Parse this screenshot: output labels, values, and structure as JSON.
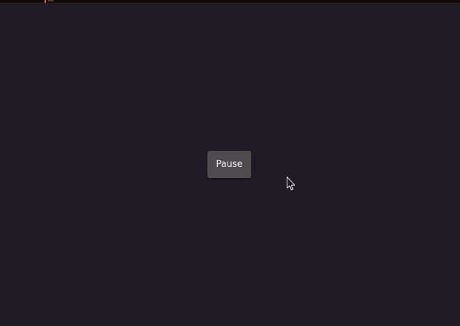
{
  "window": {
    "background_color": "#1f1c25",
    "top_bar_color": "#120d0c",
    "accent_marker_color": "#e0684a"
  },
  "controls": {
    "pause_label": "Pause",
    "pause_button_color": "#4e4b51"
  },
  "cursor": {
    "icon": "mouse-pointer-icon"
  }
}
